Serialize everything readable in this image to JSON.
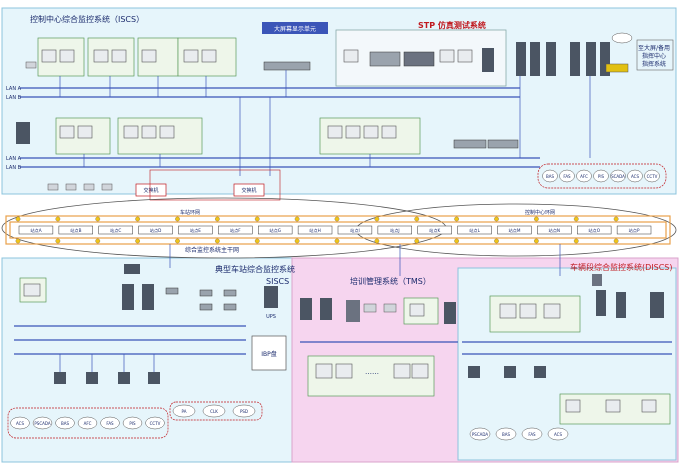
{
  "top_center_title": "大屏幕显示单元",
  "control_center": {
    "title": "控制中心综合监控系统（ISCS）"
  },
  "stp": {
    "title": "STP 仿真测试系统"
  },
  "right_note": "至大屏/备用\n指挥中心\n指挥系统",
  "lan_labels": [
    "LAN A",
    "LAN B",
    "LAN A",
    "LAN B"
  ],
  "switch_label": "交换机",
  "switch_label_2": "交换机",
  "backbone": {
    "caption": "综合监控系统主干网",
    "left_section": "车站环网",
    "right_section": "控制中心环网",
    "stations": [
      "站点A",
      "站点B",
      "站点C",
      "站点D",
      "站点E",
      "站点F",
      "站点G",
      "站点H",
      "站点I",
      "站点J",
      "站点K",
      "站点L",
      "站点M",
      "站点N",
      "站点O",
      "站点P"
    ]
  },
  "station": {
    "title": "典型车站综合监控系统",
    "subtitle": "SISCS",
    "ibp": "IBP盘",
    "ups": "UPS"
  },
  "training": {
    "title": "培训管理系统（TMS）",
    "dots": "……"
  },
  "depot": {
    "title": "车辆段综合监控系统(DISCS)"
  },
  "subsystems": {
    "control": [
      "BAS",
      "FAS",
      "AFC",
      "PIS",
      "SCADA",
      "ACS",
      "CCTV"
    ],
    "station": [
      "ACS",
      "PSCADA",
      "BAS",
      "AFC",
      "FAS",
      "PIS",
      "CCTV"
    ],
    "station_extra": [
      "PA",
      "CLK",
      "PSD"
    ],
    "depot": [
      "PSCADA",
      "BAS",
      "FAS",
      "ACS"
    ]
  }
}
